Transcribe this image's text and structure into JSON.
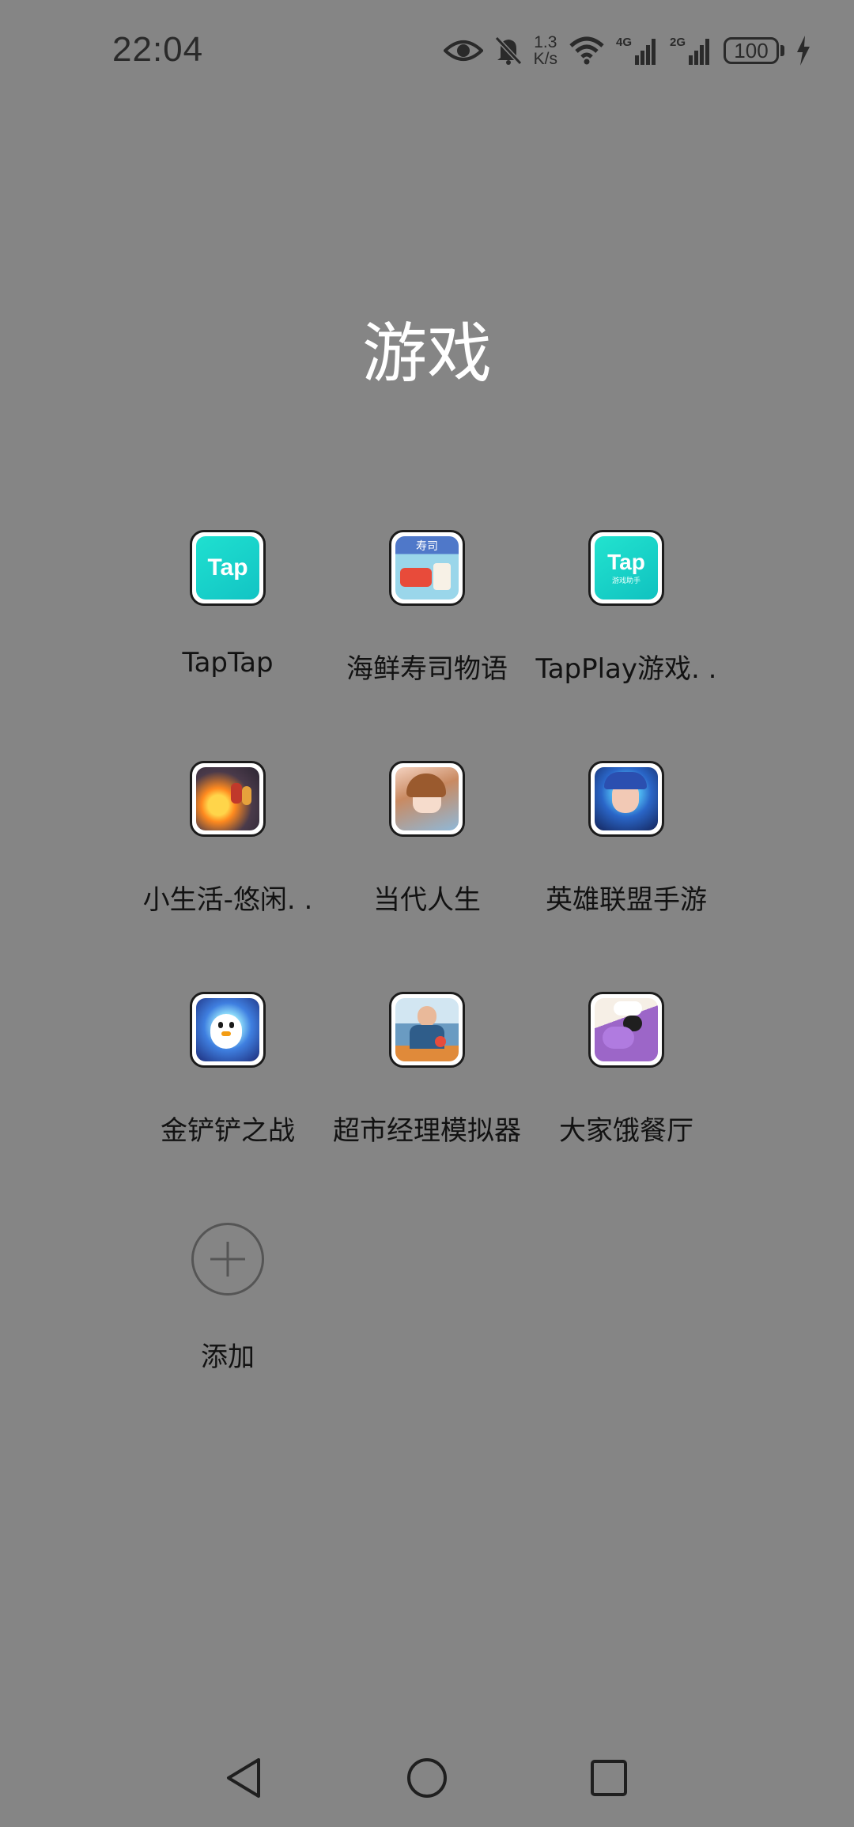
{
  "status_bar": {
    "time": "22:04",
    "net_speed_value": "1.3",
    "net_speed_unit": "K/s",
    "network_1": "4G",
    "network_2": "2G",
    "battery": "100",
    "icons": [
      "eye-icon",
      "bell-muted-icon",
      "wifi-icon",
      "signal-icon",
      "signal-icon",
      "battery-icon",
      "charging-icon"
    ]
  },
  "folder": {
    "title": "游戏"
  },
  "apps": [
    {
      "label": "TapTap",
      "icon": "taptap-app-icon",
      "icon_text": "Tap"
    },
    {
      "label": "海鲜寿司物语",
      "icon": "sushi-game-icon",
      "icon_text": "寿司"
    },
    {
      "label": "TapPlay游戏. .",
      "icon": "tapplay-app-icon",
      "icon_text": "Tap",
      "icon_subtext": "游戏助手"
    },
    {
      "label": "小生活-悠闲. .",
      "icon": "little-life-game-icon"
    },
    {
      "label": "当代人生",
      "icon": "modern-life-game-icon"
    },
    {
      "label": "英雄联盟手游",
      "icon": "league-of-legends-icon"
    },
    {
      "label": "金铲铲之战",
      "icon": "golden-spatula-icon"
    },
    {
      "label": "超市经理模拟器",
      "icon": "supermarket-sim-icon"
    },
    {
      "label": "大家饿餐厅",
      "icon": "restaurant-game-icon"
    }
  ],
  "add_button": {
    "label": "添加",
    "icon": "plus-icon"
  },
  "nav_bar": {
    "icons": [
      "back-icon",
      "home-icon",
      "recents-icon"
    ]
  },
  "colors": {
    "background": "#858585",
    "title": "#ffffff",
    "label": "#121212",
    "taptap_accent": "#14d1c8"
  }
}
